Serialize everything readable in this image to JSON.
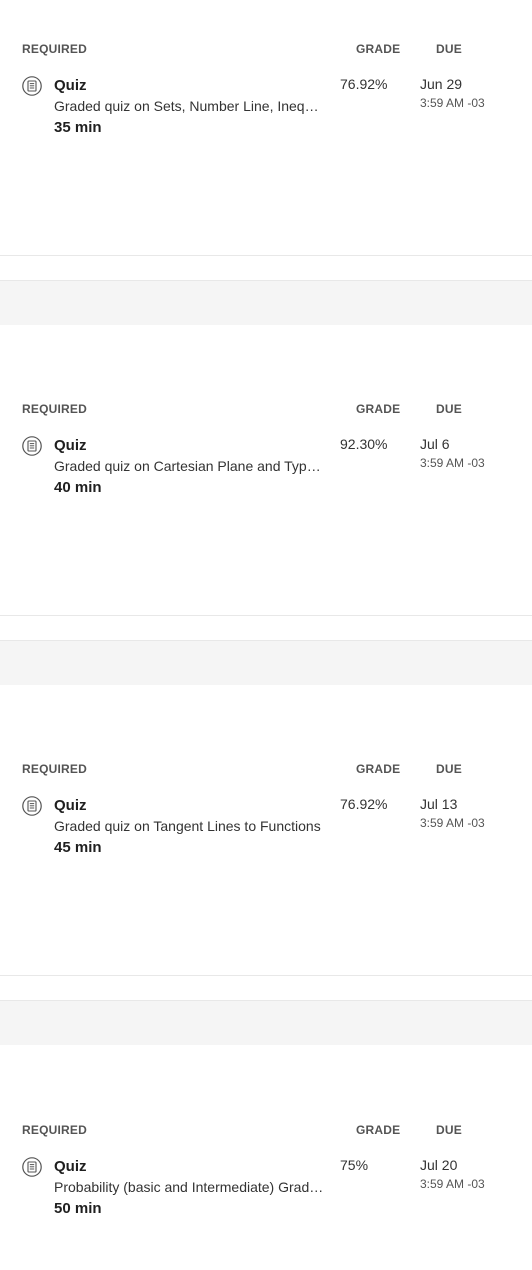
{
  "columns": {
    "required": "REQUIRED",
    "grade": "GRADE",
    "due": "DUE"
  },
  "items": [
    {
      "icon": "quiz-document-icon",
      "title": "Quiz",
      "description": "Graded quiz on Sets, Number Line, Inequalities",
      "duration": "35 min",
      "grade": "76.92%",
      "due_date": "Jun 29",
      "due_time": "3:59 AM -03"
    },
    {
      "icon": "quiz-document-icon",
      "title": "Quiz",
      "description": "Graded quiz on Cartesian Plane and Types of Functions",
      "duration": "40 min",
      "grade": "92.30%",
      "due_date": "Jul 6",
      "due_time": "3:59 AM -03"
    },
    {
      "icon": "quiz-document-icon",
      "title": "Quiz",
      "description": "Graded quiz on Tangent Lines to Functions",
      "duration": "45 min",
      "grade": "76.92%",
      "due_date": "Jul 13",
      "due_time": "3:59 AM -03"
    },
    {
      "icon": "quiz-document-icon",
      "title": "Quiz",
      "description": "Probability (basic and Intermediate) Graded Quiz",
      "duration": "50 min",
      "grade": "75%",
      "due_date": "Jul 20",
      "due_time": "3:59 AM -03"
    }
  ]
}
